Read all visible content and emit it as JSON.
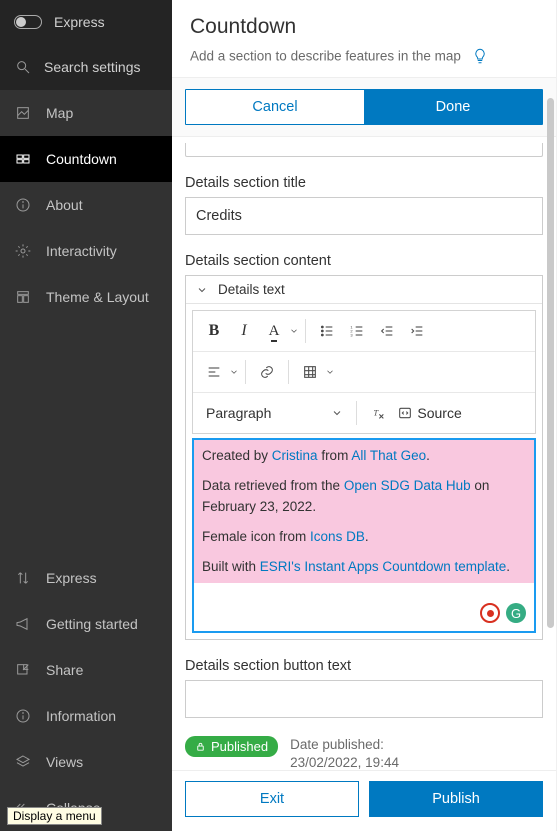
{
  "sidebar": {
    "express_label": "Express",
    "search_label": "Search settings",
    "nav": [
      {
        "label": "Map"
      },
      {
        "label": "Countdown"
      },
      {
        "label": "About"
      },
      {
        "label": "Interactivity"
      },
      {
        "label": "Theme & Layout"
      }
    ],
    "bottom": [
      {
        "label": "Express"
      },
      {
        "label": "Getting started"
      },
      {
        "label": "Share"
      },
      {
        "label": "Information"
      },
      {
        "label": "Views"
      },
      {
        "label": "Collapse"
      }
    ]
  },
  "header": {
    "title": "Countdown",
    "subtitle": "Add a section to describe features in the map"
  },
  "tabs": {
    "cancel": "Cancel",
    "done": "Done"
  },
  "form": {
    "details_title_label": "Details section title",
    "details_title_value": "Credits",
    "details_content_label": "Details section content",
    "details_text_label": "Details text",
    "paragraph_label": "Paragraph",
    "source_label": "Source",
    "details_button_label": "Details section button text",
    "details_button_value": ""
  },
  "credits": {
    "p1_a": "Created by ",
    "p1_link1": "Cristina",
    "p1_b": " from ",
    "p1_link2": "All That Geo",
    "p1_c": ".",
    "p2_a": "Data retrieved from the ",
    "p2_link": "Open SDG Data Hub",
    "p2_b": " on February 23, 2022.",
    "p3_a": "Female icon from ",
    "p3_link": "Icons DB",
    "p3_b": ".",
    "p4_a": "Built with ",
    "p4_link": "ESRI's Instant Apps Countdown template",
    "p4_b": "."
  },
  "publish": {
    "badge": "Published",
    "date_label": "Date published:",
    "date_value": "23/02/2022, 19:44"
  },
  "footer": {
    "exit": "Exit",
    "publish": "Publish"
  },
  "tooltip": "Display a menu"
}
